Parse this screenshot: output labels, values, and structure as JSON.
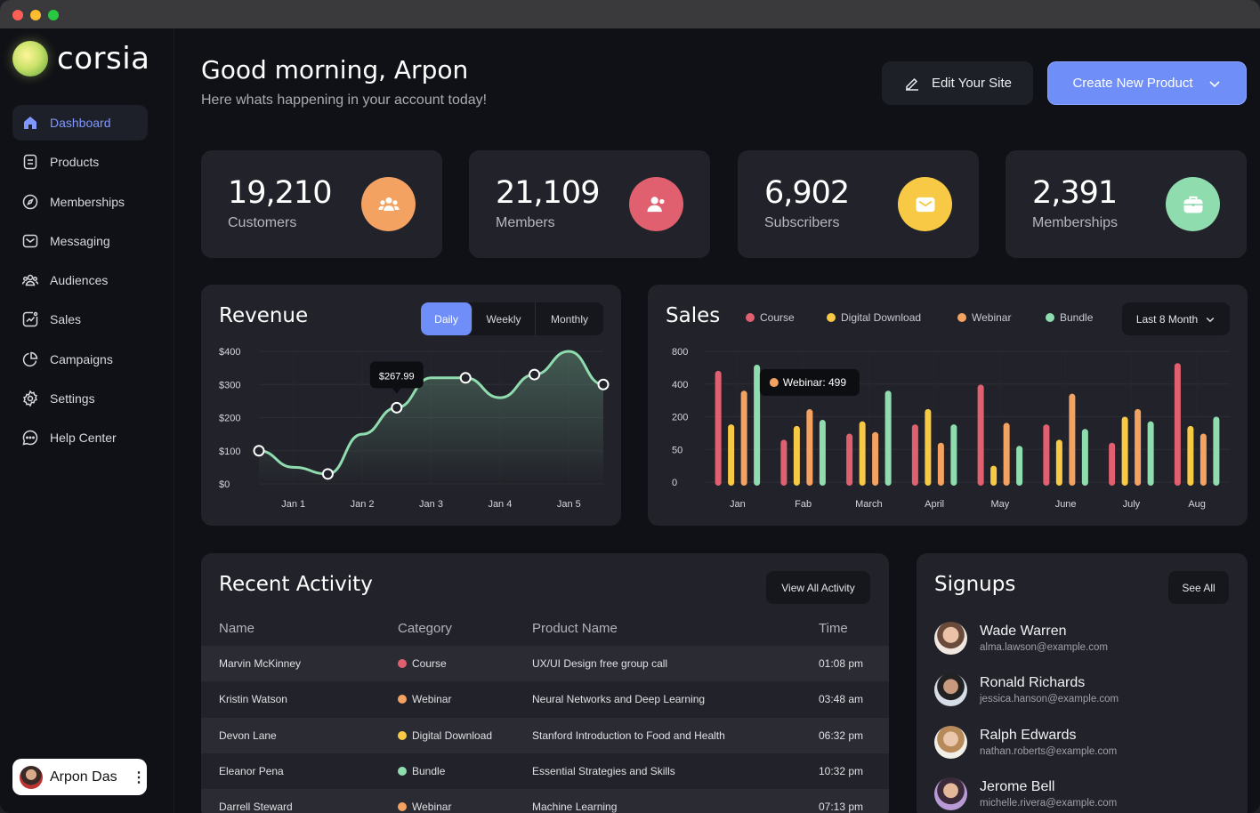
{
  "window": {
    "controls": [
      {
        "name": "close",
        "color": "#ff5f57"
      },
      {
        "name": "minimize",
        "color": "#febc2e"
      },
      {
        "name": "maximize",
        "color": "#28c840"
      }
    ]
  },
  "brand": {
    "name": "corsia"
  },
  "sidebar": {
    "items": [
      {
        "label": "Dashboard",
        "icon": "home-icon",
        "active": true
      },
      {
        "label": "Products",
        "icon": "products-icon"
      },
      {
        "label": "Memberships",
        "icon": "compass-icon"
      },
      {
        "label": "Messaging",
        "icon": "message-icon"
      },
      {
        "label": "Audiences",
        "icon": "users-icon"
      },
      {
        "label": "Sales",
        "icon": "chart-icon"
      },
      {
        "label": "Campaigns",
        "icon": "pie-icon"
      },
      {
        "label": "Settings",
        "icon": "gear-icon"
      },
      {
        "label": "Help Center",
        "icon": "help-icon"
      }
    ]
  },
  "user": {
    "name": "Arpon Das"
  },
  "header": {
    "greeting": "Good morning, Arpon",
    "subtitle": "Here whats happening in your account today!",
    "edit_label": "Edit Your Site",
    "create_label": "Create New Product"
  },
  "stats": [
    {
      "value": "19,210",
      "label": "Customers",
      "color": "#f4a261",
      "icon": "group-icon"
    },
    {
      "value": "21,109",
      "label": "Members",
      "color": "#e0606f",
      "icon": "members-icon"
    },
    {
      "value": "6,902",
      "label": "Subscribers",
      "color": "#f7c944",
      "icon": "mail-icon"
    },
    {
      "value": "2,391",
      "label": "Memberships",
      "color": "#8fdcae",
      "icon": "briefcase-icon"
    }
  ],
  "revenue": {
    "title": "Revenue",
    "tabs": [
      "Daily",
      "Weekly",
      "Monthly"
    ],
    "active_tab": "Daily",
    "tooltip": "$267.99"
  },
  "sales": {
    "title": "Sales",
    "dropdown": "Last 8 Month",
    "tooltip_label": "Webinar:",
    "tooltip_value": "499"
  },
  "chart_data": [
    {
      "type": "area",
      "title": "Revenue",
      "yticks": [
        "$400",
        "$300",
        "$200",
        "$100",
        "$0"
      ],
      "xticks": [
        "Jan 1",
        "Jan 2",
        "Jan 3",
        "Jan 4",
        "Jan 5"
      ],
      "ylim": [
        0,
        400
      ],
      "x": [
        0,
        0.5,
        1,
        1.5,
        2,
        2.5,
        3,
        3.5,
        4,
        4.5,
        5
      ],
      "points": [
        100,
        50,
        30,
        150,
        230,
        320,
        320,
        260,
        330,
        400,
        300
      ],
      "markers": [
        0,
        2,
        4,
        6,
        8,
        10
      ],
      "color": "#8fdcae",
      "grid": true
    },
    {
      "type": "bar",
      "title": "Sales",
      "yticks": [
        "800",
        "400",
        "200",
        "50",
        "0"
      ],
      "categories": [
        "Jan",
        "Fab",
        "March",
        "April",
        "May",
        "June",
        "July",
        "Aug"
      ],
      "series": [
        {
          "name": "Course",
          "color": "#e0606f",
          "values": [
            750,
            300,
            340,
            400,
            660,
            400,
            280,
            800
          ]
        },
        {
          "name": "Digital Download",
          "color": "#f7c944",
          "values": [
            400,
            390,
            420,
            500,
            130,
            300,
            450,
            390
          ]
        },
        {
          "name": "Webinar",
          "color": "#f4a261",
          "values": [
            620,
            499,
            350,
            280,
            410,
            600,
            500,
            340
          ]
        },
        {
          "name": "Bundle",
          "color": "#8fdcae",
          "values": [
            790,
            430,
            620,
            400,
            260,
            370,
            420,
            450
          ]
        }
      ],
      "ylim": [
        0,
        900
      ],
      "grid": true
    }
  ],
  "activity": {
    "title": "Recent Activity",
    "view_all": "View All Activity",
    "columns": [
      "Name",
      "Category",
      "Product Name",
      "Time"
    ],
    "rows": [
      {
        "name": "Marvin McKinney",
        "category": "Course",
        "color": "#e0606f",
        "product": "UX/UI Design free group call",
        "time": "01:08 pm"
      },
      {
        "name": "Kristin Watson",
        "category": "Webinar",
        "color": "#f4a261",
        "product": "Neural Networks and Deep Learning",
        "time": "03:48 am"
      },
      {
        "name": "Devon Lane",
        "category": "Digital Download",
        "color": "#f7c944",
        "product": "Stanford Introduction to Food and Health",
        "time": "06:32 pm"
      },
      {
        "name": "Eleanor Pena",
        "category": "Bundle",
        "color": "#8fdcae",
        "product": "Essential Strategies and Skills",
        "time": "10:32 pm"
      },
      {
        "name": "Darrell Steward",
        "category": "Webinar",
        "color": "#f4a261",
        "product": "Machine Learning",
        "time": "07:13 pm"
      }
    ]
  },
  "signups": {
    "title": "Signups",
    "see_all": "See All",
    "items": [
      {
        "name": "Wade Warren",
        "email": "alma.lawson@example.com"
      },
      {
        "name": "Ronald Richards",
        "email": "jessica.hanson@example.com"
      },
      {
        "name": "Ralph Edwards",
        "email": "nathan.roberts@example.com"
      },
      {
        "name": "Jerome Bell",
        "email": "michelle.rivera@example.com"
      }
    ]
  }
}
